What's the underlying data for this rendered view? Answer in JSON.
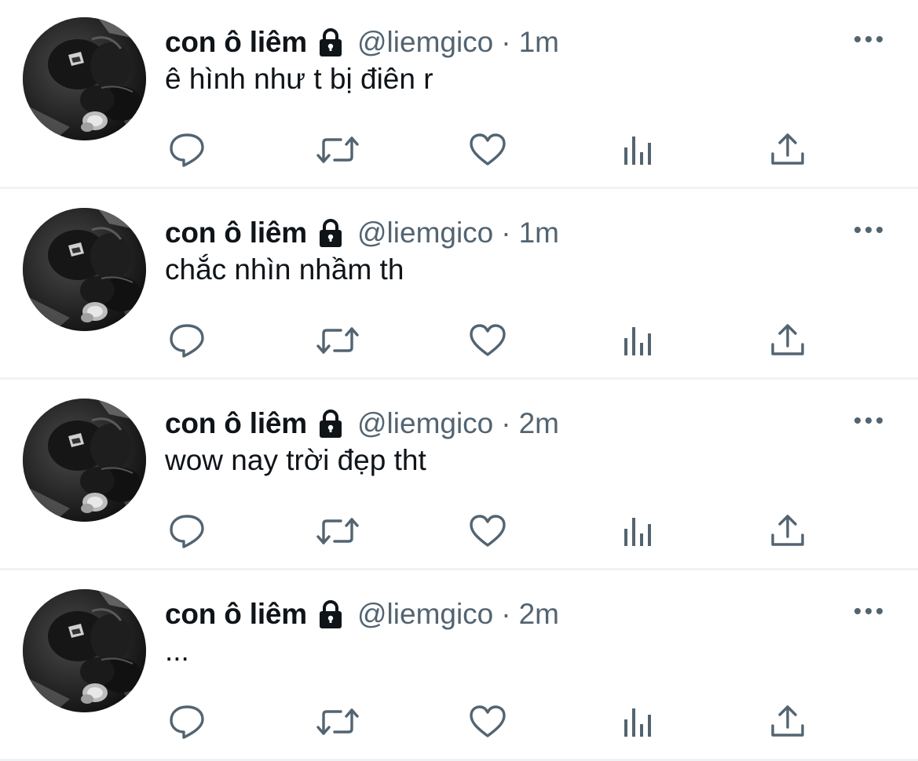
{
  "colors": {
    "text_primary": "#0f1419",
    "text_secondary": "#536471",
    "divider": "#eff3f4",
    "background": "#ffffff"
  },
  "icons": {
    "lock": "lock-icon",
    "more": "more-horizontal-icon",
    "reply": "reply-icon",
    "retweet": "retweet-icon",
    "like": "like-heart-icon",
    "analytics": "analytics-icon",
    "share": "share-icon"
  },
  "tweets": [
    {
      "name": "con ô liêm",
      "handle": "@liemgico",
      "separator": "·",
      "time": "1m",
      "text": "ê hình như t bị điên r"
    },
    {
      "name": "con ô liêm",
      "handle": "@liemgico",
      "separator": "·",
      "time": "1m",
      "text": "chắc nhìn nhầm th"
    },
    {
      "name": "con ô liêm",
      "handle": "@liemgico",
      "separator": "·",
      "time": "2m",
      "text": "wow nay trời đẹp tht"
    },
    {
      "name": "con ô liêm",
      "handle": "@liemgico",
      "separator": "·",
      "time": "2m",
      "text": "..."
    }
  ]
}
